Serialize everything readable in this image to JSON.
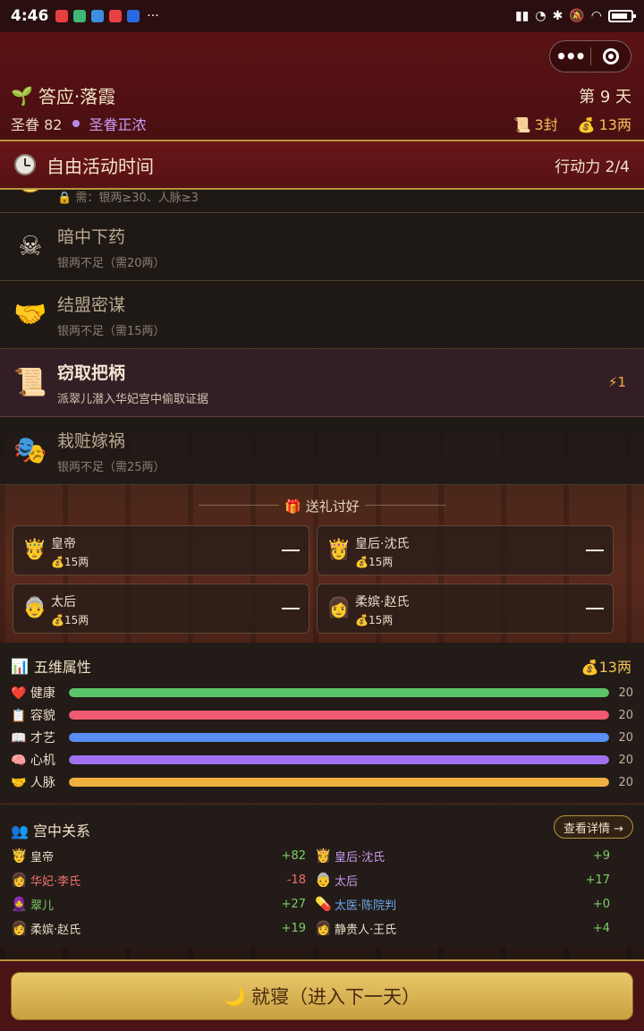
{
  "statusbar": {
    "time": "4:46",
    "dots": "···"
  },
  "header": {
    "title": "答应·落霞",
    "day": "第 9 天",
    "favor_label": "圣眷 82",
    "favor_status": "圣眷正浓",
    "letters": "3封",
    "money": "13两"
  },
  "activity": {
    "title": "自由活动时间",
    "power": "行动力 2/4"
  },
  "actions": [
    {
      "name": "",
      "desc": "需：银两≥30、人脉≥3",
      "icon": "coin-icon"
    },
    {
      "name": "暗中下药",
      "desc": "银两不足（需20两）",
      "icon": "skull-icon"
    },
    {
      "name": "结盟密谋",
      "desc": "银两不足（需15两）",
      "icon": "handshake-icon"
    },
    {
      "name": "窃取把柄",
      "desc": "派翠儿潜入华妃宫中偷取证据",
      "energy": "⚡1",
      "icon": "scroll-icon"
    },
    {
      "name": "栽赃嫁祸",
      "desc": "银两不足（需25两）",
      "icon": "masks-icon"
    }
  ],
  "gifts": {
    "title": "送礼讨好",
    "cards": [
      {
        "name": "皇帝",
        "cost": "💰15两"
      },
      {
        "name": "皇后·沈氏",
        "cost": "💰15两"
      },
      {
        "name": "太后",
        "cost": "💰15两"
      },
      {
        "name": "柔嫔·赵氏",
        "cost": "💰15两"
      }
    ]
  },
  "attributes": {
    "title": "五维属性",
    "money": "13两",
    "items": [
      {
        "label": "健康",
        "value": "20",
        "level": 1.0,
        "color": "#5cc56a"
      },
      {
        "label": "容貌",
        "value": "20",
        "level": 1.0,
        "color": "#f05a72"
      },
      {
        "label": "才艺",
        "value": "20",
        "level": 1.0,
        "color": "#5a8ef5"
      },
      {
        "label": "心机",
        "value": "20",
        "level": 1.0,
        "color": "#a070f0"
      },
      {
        "label": "人脉",
        "value": "20",
        "level": 1.0,
        "color": "#f0b040"
      }
    ]
  },
  "relations": {
    "title": "宫中关系",
    "detail_button": "查看详情 →",
    "items": [
      {
        "name": "皇帝",
        "value": "+82",
        "name_color": "#e8dcc8",
        "value_color": "#7ccf6a"
      },
      {
        "name": "皇后·沈氏",
        "value": "+9",
        "name_color": "#c89af0",
        "value_color": "#7ccf6a"
      },
      {
        "name": "华妃·李氏",
        "value": "-18",
        "name_color": "#f07070",
        "value_color": "#f07070"
      },
      {
        "name": "太后",
        "value": "+17",
        "name_color": "#c89af0",
        "value_color": "#7ccf6a"
      },
      {
        "name": "翠儿",
        "value": "+27",
        "name_color": "#7ccf6a",
        "value_color": "#7ccf6a"
      },
      {
        "name": "太医·陈院判",
        "value": "+0",
        "name_color": "#6aa8f0",
        "value_color": "#7ccf6a"
      },
      {
        "name": "柔嫔·赵氏",
        "value": "+19",
        "name_color": "#e8dcc8",
        "value_color": "#7ccf6a"
      },
      {
        "name": "静贵人·王氏",
        "value": "+4",
        "name_color": "#e8dcc8",
        "value_color": "#7ccf6a"
      }
    ]
  },
  "sleep_button": "就寝（进入下一天）"
}
